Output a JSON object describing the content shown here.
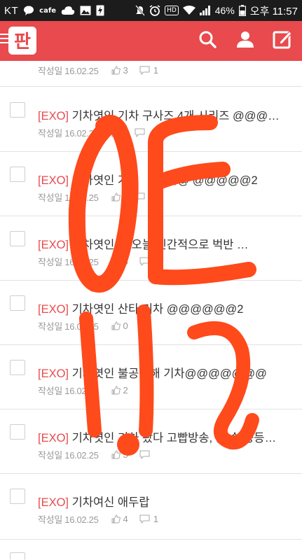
{
  "status_bar": {
    "carrier": "KT",
    "cafe": "cafe",
    "hd": "HD",
    "battery": "46%",
    "time": "오후 11:57"
  },
  "header": {
    "logo_text": "판",
    "brand_color": "#e84a4d"
  },
  "first_item_meta": {
    "date": "작성일 16.02.25",
    "likes": "3",
    "comments": "1"
  },
  "items": [
    {
      "tag": "[EXO]",
      "title": " 기차엿인 기차 구사즈 4개 시리즈 @@@…",
      "date": "작성일 16.02.25",
      "likes": "",
      "comments": ""
    },
    {
      "tag": "[EXO]",
      "title": " 기차엿인 가",
      "title_tail": "기차@ @@@@@2",
      "date": "작성일 16.02.25",
      "likes": "",
      "comments": ""
    },
    {
      "tag": "[EXO]",
      "title": " 기차엿인 나 오늘 인간적으로 벅반 …",
      "date": "작성일 16.02.25",
      "likes": "6",
      "comments": "4"
    },
    {
      "tag": "[EXO]",
      "title": " 기차엿인 산타 기차 @@@@@@2",
      "date": "작성일 16.02.25",
      "likes": "0",
      "comments": ""
    },
    {
      "tag": "[EXO]",
      "title": " 기차엿인 불공평해 기차@@@@@@@",
      "date": "작성일 16.02.25",
      "likes": "2",
      "comments": ""
    },
    {
      "tag": "[EXO]",
      "title": " 기차엿인 기차 왔다 고빱방송, 존 송 등등…",
      "date": "작성일 16.02.25",
      "likes": "5",
      "comments": ""
    },
    {
      "tag": "[EXO]",
      "title": " 기차여신 애두랍",
      "date": "작성일 16.02.25",
      "likes": "4",
      "comments": "1"
    }
  ],
  "overlay": {
    "handwritten_text": "OE 1112",
    "ink_color": "#ff4a1c"
  }
}
